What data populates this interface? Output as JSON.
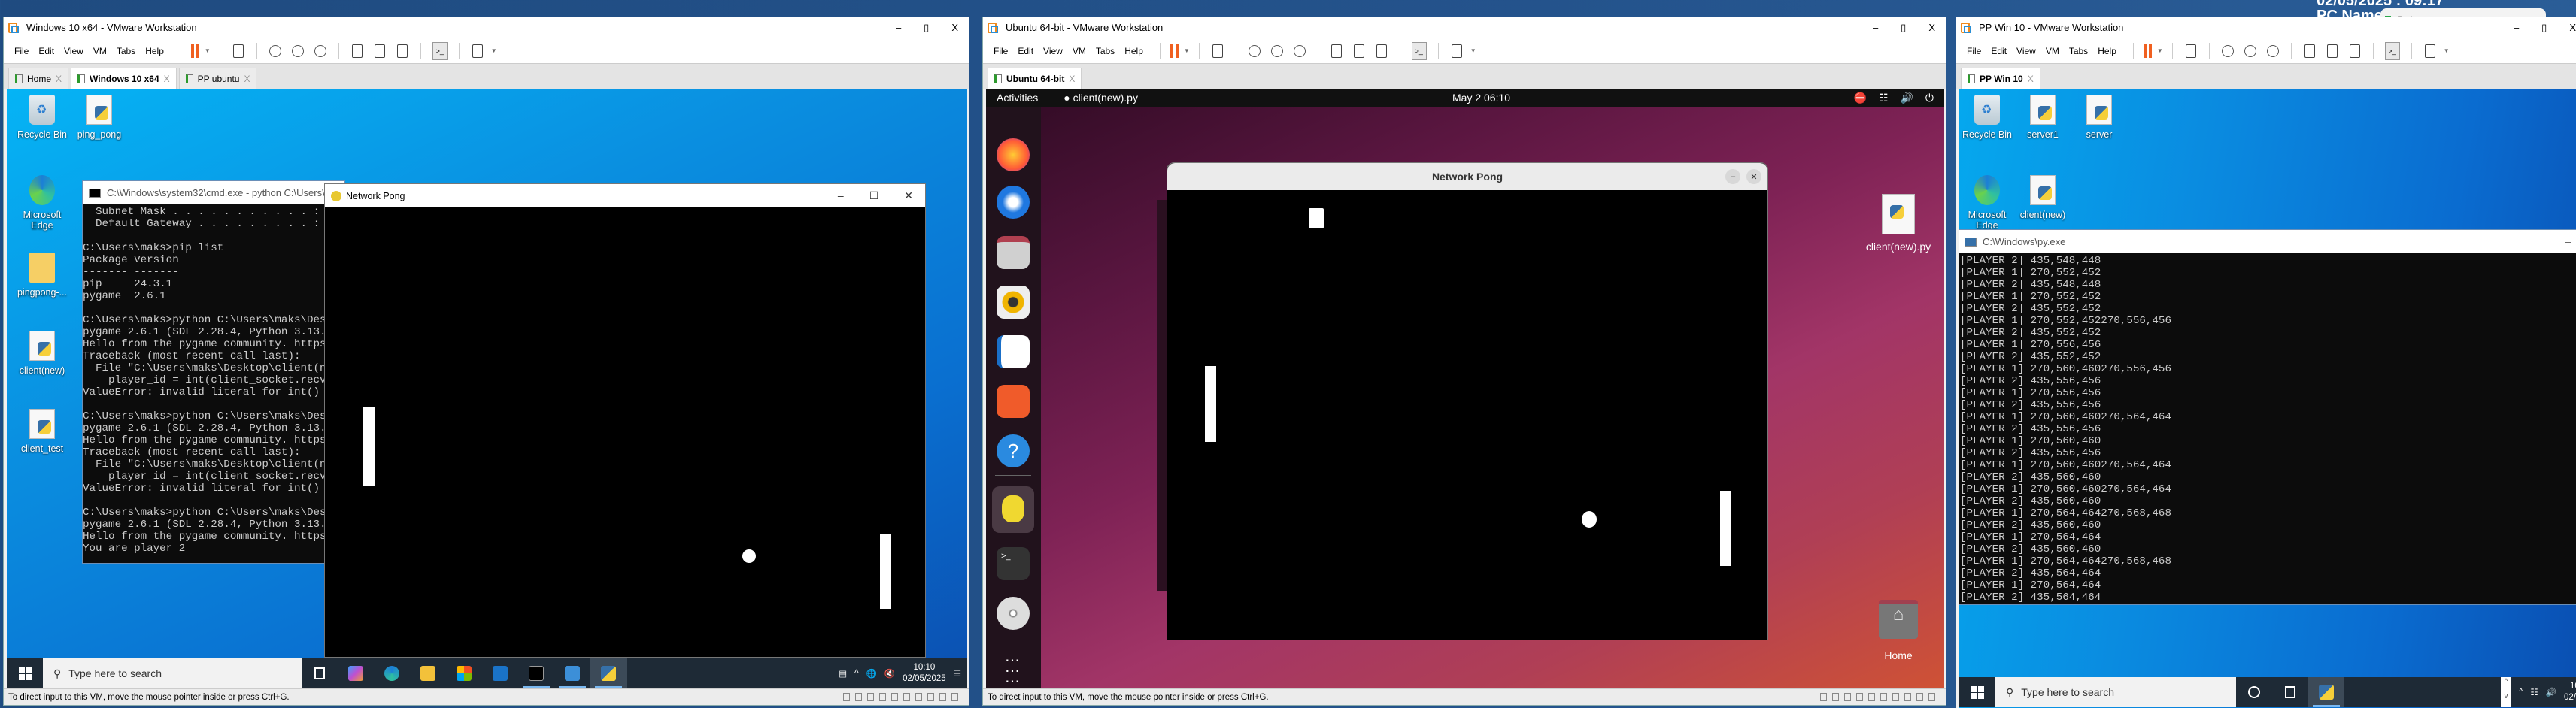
{
  "host": {
    "datetime": "02/05/2025 : 09:17",
    "pc_name": "PC Name : ",
    "balance_title": "Balance"
  },
  "menu": [
    "File",
    "Edit",
    "View",
    "VM",
    "Tabs",
    "Help"
  ],
  "vms": {
    "left": {
      "title": "Windows 10 x64 - VMware Workstation",
      "tabs": [
        {
          "label": "Home",
          "active": false
        },
        {
          "label": "Windows 10 x64",
          "active": true
        },
        {
          "label": "PP ubuntu",
          "active": false
        }
      ],
      "status": "To direct input to this VM, move the mouse pointer inside or press Ctrl+G."
    },
    "ubuntu": {
      "title": "Ubuntu 64-bit - VMware Workstation",
      "tabs": [
        {
          "label": "Ubuntu 64-bit",
          "active": true
        }
      ],
      "status": "To direct input to this VM, move the mouse pointer inside or press Ctrl+G."
    },
    "right": {
      "title": "PP Win 10 - VMware Workstation",
      "tabs": [
        {
          "label": "PP Win 10",
          "active": true
        }
      ]
    }
  },
  "win10": {
    "desktop_icons": [
      "Recycle Bin",
      "ping_pong",
      "Microsoft Edge",
      "pingpong-...",
      "client(new)",
      "client_test"
    ],
    "cmd": {
      "title": "C:\\Windows\\system32\\cmd.exe - python  C:\\Users\\mak",
      "lines": [
        "  Subnet Mask . . . . . . . . . . . : 2",
        "  Default Gateway . . . . . . . . . : 1",
        "",
        "C:\\Users\\maks>pip list",
        "Package Version",
        "------- -------",
        "pip     24.3.1",
        "pygame  2.6.1",
        "",
        "C:\\Users\\maks>python C:\\Users\\maks\\Deskt",
        "pygame 2.6.1 (SDL 2.28.4, Python 3.13.2)",
        "Hello from the pygame community. https:/",
        "Traceback (most recent call last):",
        "  File \"C:\\Users\\maks\\Desktop\\client(new",
        "    player_id = int(client_socket.recv(1",
        "ValueError: invalid literal for int() wi",
        "",
        "C:\\Users\\maks>python C:\\Users\\maks\\Deskt",
        "pygame 2.6.1 (SDL 2.28.4, Python 3.13.2)",
        "Hello from the pygame community. https:/",
        "Traceback (most recent call last):",
        "  File \"C:\\Users\\maks\\Desktop\\client(new",
        "    player_id = int(client_socket.recv(1",
        "ValueError: invalid literal for int() wi",
        "",
        "C:\\Users\\maks>python C:\\Users\\maks\\Deskt",
        "pygame 2.6.1 (SDL 2.28.4, Python 3.13.2)",
        "Hello from the pygame community. https:/",
        "You are player 2"
      ]
    },
    "pong_title": "Network Pong",
    "search_placeholder": "Type here to search",
    "clock_time": "10:10",
    "clock_date": "02/05/2025"
  },
  "ubuntu": {
    "activities": "Activities",
    "app_name": "client(new).py",
    "clock": "May 2  06:10",
    "pong_title": "Network Pong",
    "desktop_icons": [
      "client(new).py",
      "Home"
    ]
  },
  "pp_win10": {
    "desktop_icons": [
      "Recycle Bin",
      "server1",
      "server",
      "Microsoft Edge",
      "client(new)"
    ],
    "console": {
      "title": "C:\\Windows\\py.exe",
      "lines": [
        "[PLAYER 2] 435,548,448",
        "[PLAYER 1] 270,552,452",
        "[PLAYER 2] 435,548,448",
        "[PLAYER 1] 270,552,452",
        "[PLAYER 2] 435,552,452",
        "[PLAYER 1] 270,552,452270,556,456",
        "[PLAYER 2] 435,552,452",
        "[PLAYER 1] 270,556,456",
        "[PLAYER 2] 435,552,452",
        "[PLAYER 1] 270,560,460270,556,456",
        "[PLAYER 2] 435,556,456",
        "[PLAYER 1] 270,556,456",
        "[PLAYER 2] 435,556,456",
        "[PLAYER 1] 270,560,460270,564,464",
        "[PLAYER 2] 435,556,456",
        "[PLAYER 1] 270,560,460",
        "[PLAYER 2] 435,556,456",
        "[PLAYER 1] 270,560,460270,564,464",
        "[PLAYER 2] 435,560,460",
        "[PLAYER 1] 270,560,460270,564,464",
        "[PLAYER 2] 435,560,460",
        "[PLAYER 1] 270,564,464270,568,468",
        "[PLAYER 2] 435,560,460",
        "[PLAYER 1] 270,564,464",
        "[PLAYER 2] 435,560,460",
        "[PLAYER 1] 270,564,464270,568,468",
        "[PLAYER 2] 435,564,464",
        "[PLAYER 1] 270,564,464",
        "[PLAYER 2] 435,564,464"
      ]
    },
    "search_placeholder": "Type here to search",
    "clock_time": "10:",
    "clock_date": "02/05/"
  },
  "colors": {
    "pause": "#f06020",
    "win_accent": "#0078d7",
    "ubuntu_top": "#111111"
  }
}
